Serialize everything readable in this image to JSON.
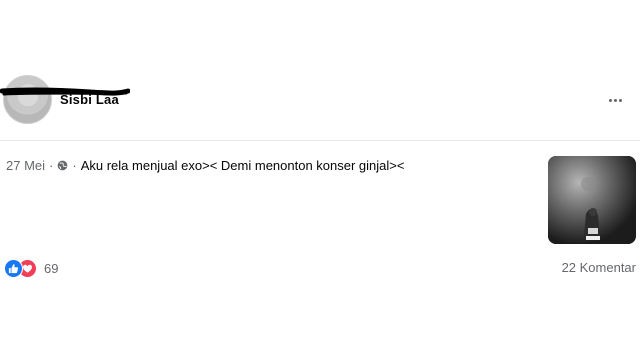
{
  "post": {
    "author_name": "Sisbi Laa",
    "timestamp": "27 Mei",
    "separator": "·",
    "audience_icon": "globe-icon",
    "text": "Aku rela menjual exo>< Demi menonton konser ginjal><",
    "more_icon": "more-horizontal-icon",
    "has_photo": true
  },
  "reactions": {
    "icons": [
      "like-icon",
      "love-icon"
    ],
    "count": "69"
  },
  "comments": {
    "label": "22 Komentar"
  },
  "colors": {
    "like_blue": "#1877f2",
    "love_red": "#f33e58",
    "secondary_text": "#65676b",
    "divider": "#e4e6eb"
  }
}
